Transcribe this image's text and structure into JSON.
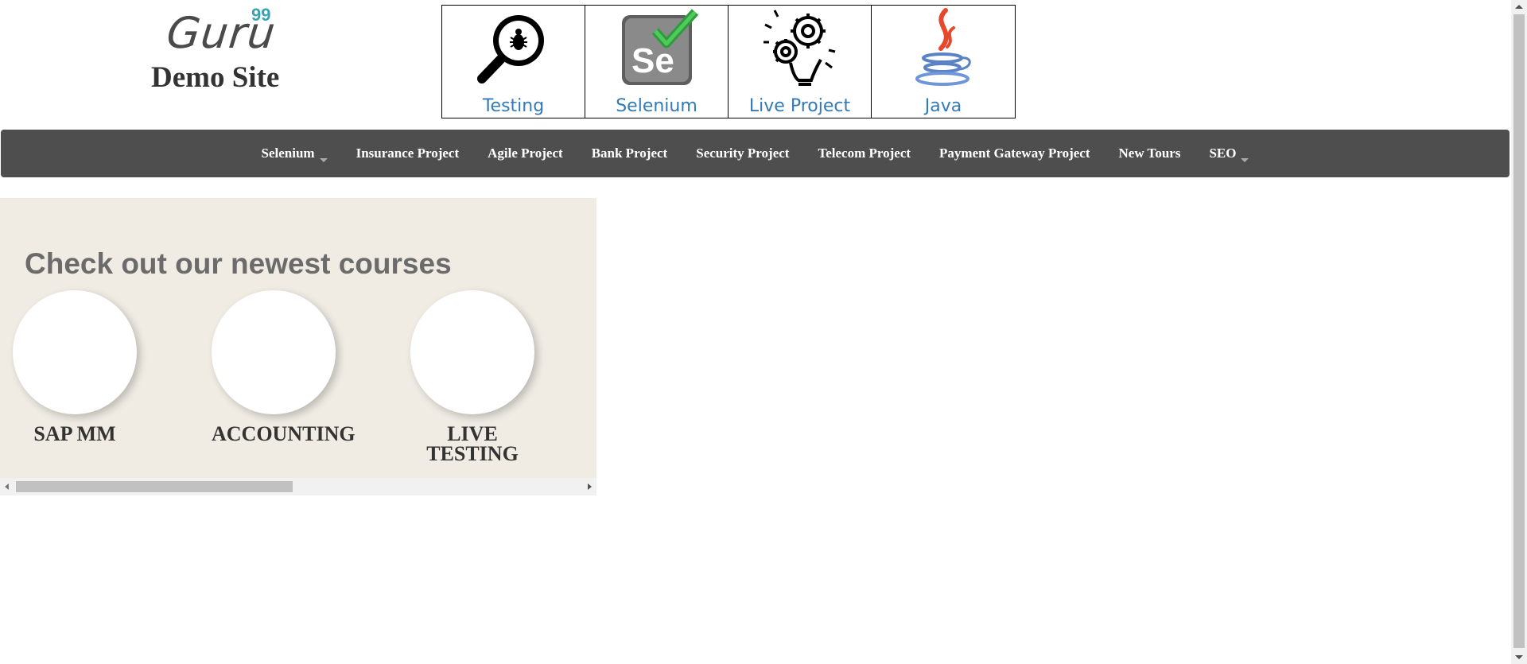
{
  "logo": {
    "guru": "Guru",
    "superscript": "99",
    "site_name": "Demo Site"
  },
  "tiles": [
    {
      "label": "Testing",
      "icon": "magnifier-bug-icon"
    },
    {
      "label": "Selenium",
      "icon": "selenium-check-icon"
    },
    {
      "label": "Live Project",
      "icon": "gears-bulb-icon"
    },
    {
      "label": "Java",
      "icon": "java-cup-icon"
    }
  ],
  "nav": {
    "items": [
      {
        "label": "Selenium",
        "dropdown": true
      },
      {
        "label": "Insurance Project"
      },
      {
        "label": "Agile Project"
      },
      {
        "label": "Bank Project"
      },
      {
        "label": "Security Project"
      },
      {
        "label": "Telecom Project"
      },
      {
        "label": "Payment Gateway Project"
      },
      {
        "label": "New Tours"
      },
      {
        "label": "SEO",
        "dropdown": true
      }
    ]
  },
  "courses": {
    "heading": "Check out our newest courses",
    "items": [
      {
        "title": "SAP MM"
      },
      {
        "title": "ACCOUNTING"
      },
      {
        "title": "LIVE TESTING"
      }
    ]
  },
  "colors": {
    "nav_bg": "#4e4e4e",
    "tile_label": "#337ab7",
    "courses_bg": "#f0ece4",
    "logo_accent": "#3aa3b1"
  }
}
